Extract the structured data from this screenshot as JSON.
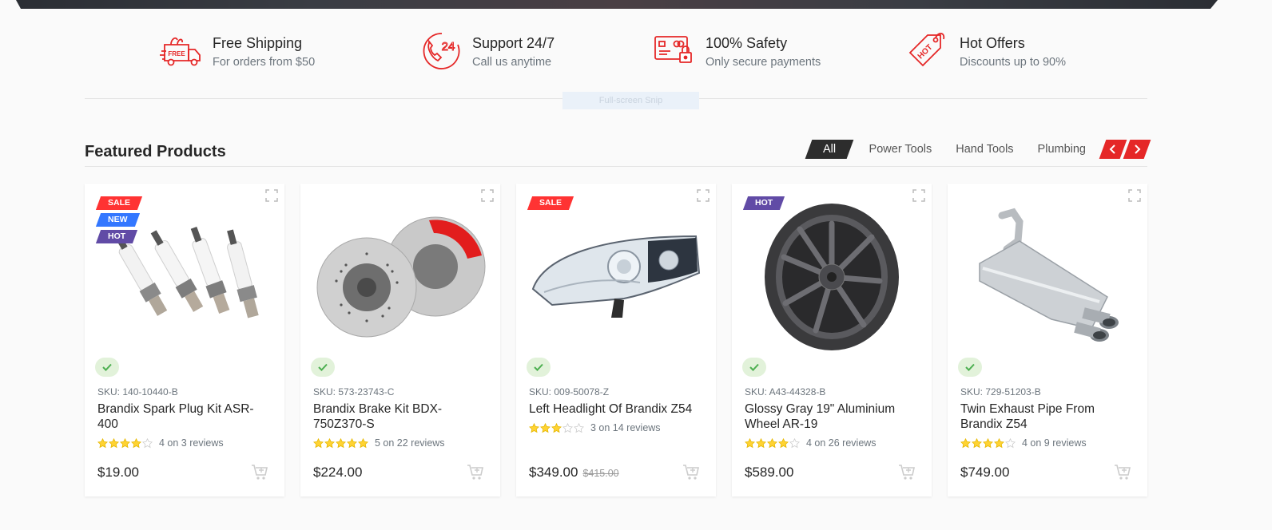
{
  "features": [
    {
      "icon": "free-shipping-truck-icon",
      "icon_text": "FREE",
      "title": "Free Shipping",
      "subtitle": "For orders from $50"
    },
    {
      "icon": "support-24-phone-icon",
      "icon_text": "24",
      "title": "Support 24/7",
      "subtitle": "Call us anytime"
    },
    {
      "icon": "secure-payment-card-icon",
      "title": "100% Safety",
      "subtitle": "Only secure payments"
    },
    {
      "icon": "hot-offer-tag-icon",
      "icon_text": "HOT",
      "title": "Hot Offers",
      "subtitle": "Discounts up to 90%"
    }
  ],
  "overlay": {
    "snip_label": "Full-screen Snip"
  },
  "section": {
    "title": "Featured Products",
    "tabs": [
      {
        "label": "All",
        "active": true
      },
      {
        "label": "Power Tools",
        "active": false
      },
      {
        "label": "Hand Tools",
        "active": false
      },
      {
        "label": "Plumbing",
        "active": false
      }
    ]
  },
  "colors": {
    "accent": "#e52727",
    "sale": "#ff3333",
    "new": "#3377ff",
    "hot": "#614ba6",
    "star": "#ffd333",
    "stock_bg": "#e2f2da",
    "stock_check": "#4caf50"
  },
  "products": [
    {
      "badges": [
        {
          "type": "sale",
          "label": "SALE"
        },
        {
          "type": "new",
          "label": "NEW"
        },
        {
          "type": "hot",
          "label": "HOT"
        }
      ],
      "image": "spark-plugs",
      "sku": "SKU: 140-10440-B",
      "name": "Brandix Spark Plug Kit ASR-400",
      "rating": 4,
      "reviews_text": "4 on 3 reviews",
      "price": "$19.00",
      "old_price": ""
    },
    {
      "badges": [],
      "image": "brake-discs",
      "sku": "SKU: 573-23743-C",
      "name": "Brandix Brake Kit BDX-750Z370-S",
      "rating": 5,
      "reviews_text": "5 on 22 reviews",
      "price": "$224.00",
      "old_price": ""
    },
    {
      "badges": [
        {
          "type": "sale",
          "label": "SALE"
        }
      ],
      "image": "headlight",
      "sku": "SKU: 009-50078-Z",
      "name": "Left Headlight Of Brandix Z54",
      "rating": 3,
      "reviews_text": "3 on 14 reviews",
      "price": "$349.00",
      "old_price": "$415.00"
    },
    {
      "badges": [
        {
          "type": "hot",
          "label": "HOT"
        }
      ],
      "image": "wheel",
      "sku": "SKU: A43-44328-B",
      "name": "Glossy Gray 19\" Aluminium Wheel AR-19",
      "rating": 4,
      "reviews_text": "4 on 26 reviews",
      "price": "$589.00",
      "old_price": ""
    },
    {
      "badges": [],
      "image": "exhaust-pipe",
      "sku": "SKU: 729-51203-B",
      "name": "Twin Exhaust Pipe From Brandix Z54",
      "rating": 4,
      "reviews_text": "4 on 9 reviews",
      "price": "$749.00",
      "old_price": ""
    }
  ]
}
